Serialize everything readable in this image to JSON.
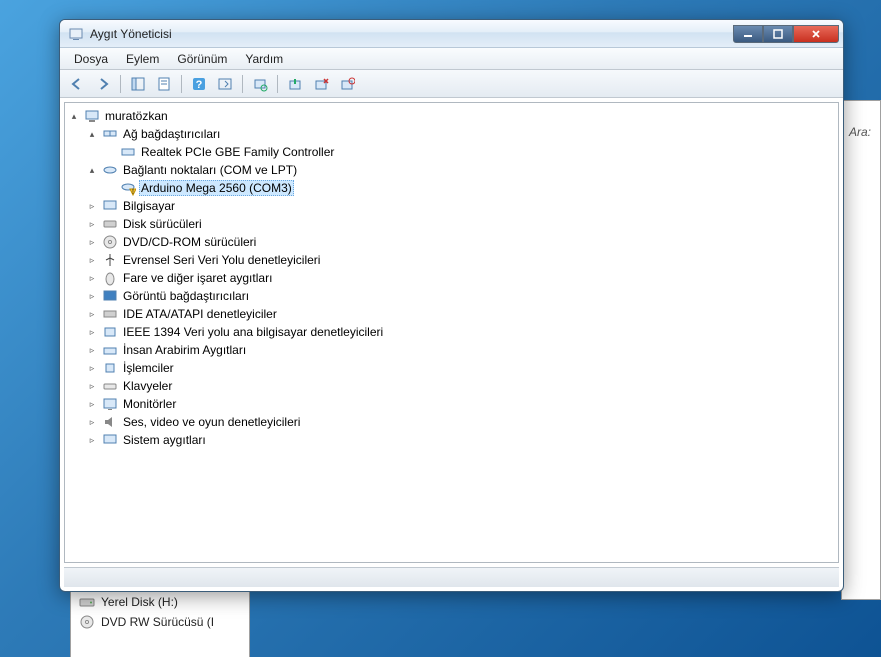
{
  "background": {
    "search_label": "Ara:",
    "drive_label": "Yerel Disk (H:)",
    "dvd_label": "DVD RW Sürücüsü (I"
  },
  "window": {
    "title": "Aygıt Yöneticisi"
  },
  "menu": {
    "file": "Dosya",
    "action": "Eylem",
    "view": "Görünüm",
    "help": "Yardım"
  },
  "tree": {
    "root": "muratözkan",
    "network_adapters": "Ağ bağdaştırıcıları",
    "realtek": "Realtek PCIe GBE Family Controller",
    "ports": "Bağlantı noktaları (COM ve LPT)",
    "arduino": "Arduino Mega 2560 (COM3)",
    "computer": "Bilgisayar",
    "disk": "Disk sürücüleri",
    "dvd": "DVD/CD-ROM sürücüleri",
    "usb": "Evrensel Seri Veri Yolu denetleyicileri",
    "mouse": "Fare ve diğer işaret aygıtları",
    "display": "Görüntü bağdaştırıcıları",
    "ide": "IDE ATA/ATAPI denetleyiciler",
    "ieee": "IEEE 1394 Veri yolu ana bilgisayar denetleyicileri",
    "hid": "İnsan Arabirim Aygıtları",
    "cpu": "İşlemciler",
    "keyboard": "Klavyeler",
    "monitor": "Monitörler",
    "audio": "Ses, video ve oyun denetleyicileri",
    "system": "Sistem aygıtları"
  }
}
